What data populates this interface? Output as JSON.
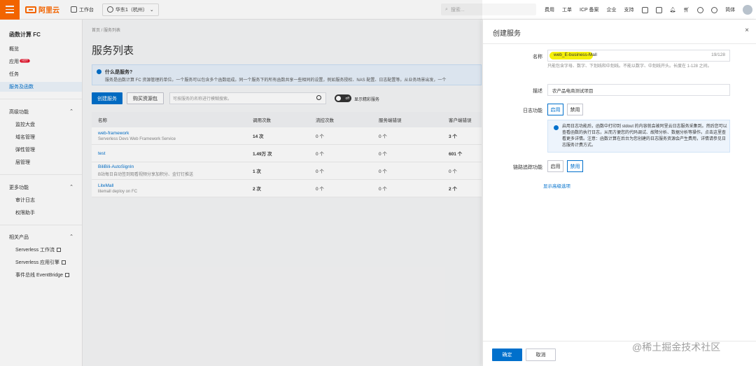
{
  "topbar": {
    "logo": "阿里云",
    "workbench": "工作台",
    "region": "华东1（杭州）",
    "search_placeholder": "搜索...",
    "links": [
      "费用",
      "工单",
      "ICP 备案",
      "企业",
      "支持"
    ],
    "lang": "简体"
  },
  "sidebar": {
    "title": "函数计算 FC",
    "items": [
      "概览",
      "应用",
      "任务",
      "服务及函数"
    ],
    "hot_badge": "HOT",
    "section_advanced": "高级功能",
    "advanced_items": [
      "监控大盘",
      "域名管理",
      "弹性管理",
      "层管理"
    ],
    "section_more": "更多功能",
    "more_items": [
      "审计日志",
      "权限助手"
    ],
    "section_related": "相关产品",
    "related_items": [
      "Serverless 工作流",
      "Serverless 应用引擎",
      "事件总线 EventBridge"
    ]
  },
  "main": {
    "breadcrumb": "首页 / 服务列表",
    "title": "服务列表",
    "notice_title": "什么是服务?",
    "notice_text": "服务是函数计算 FC 资源管理的单位。一个服务可以包含多个函数组成。同一个服务下的所有函数共享一些相同的设置，例如服务授权、NAS 配置、日志配置等。从业务场景出发，一个",
    "create_button": "创建服务",
    "resource_pack_button": "购买资源包",
    "filter_placeholder": "可按服务的名称进行模糊搜索。",
    "toggle_text": "off",
    "toggle_label": "显示精彩服务",
    "columns": [
      "名称",
      "调用次数",
      "流控次数",
      "服务端错误",
      "客户端错误"
    ],
    "rows": [
      {
        "name": "web-framework",
        "desc": "Serverless Devs Web Framework Service",
        "calls": "14 次",
        "throttles": "0 个",
        "server_errors": "0 个",
        "client_errors": "3 个"
      },
      {
        "name": "test",
        "desc": "",
        "calls": "1.49万 次",
        "throttles": "0 个",
        "server_errors": "0 个",
        "client_errors": "601 个"
      },
      {
        "name": "BiliBili-AutoSignIn",
        "desc": "B站每日自动签到观看视频分享加积分、金钉钉推送",
        "calls": "1 次",
        "throttles": "0 个",
        "server_errors": "0 个",
        "client_errors": "0 个"
      },
      {
        "name": "LiteMall",
        "desc": "litemall deploy on FC",
        "calls": "2 次",
        "throttles": "0 个",
        "server_errors": "0 个",
        "client_errors": "2 个"
      }
    ]
  },
  "drawer": {
    "title": "创建服务",
    "close": "×",
    "name_label": "名称",
    "name_value": "web_E-business-Mall",
    "name_count": "19/128",
    "name_hint": "只能包含字母、数字、下划线和中划线。不能以数字、中划线开头。长度在 1-128 之间。",
    "desc_label": "描述",
    "desc_value": "农产品电商测试项目",
    "log_label": "日志功能",
    "enable": "启用",
    "disable": "禁用",
    "log_info": "启用日志功能后，函数中打印到 stdout 的内容就会被阿里云日志服务采集到。然后您可以查看函数的执行日志，从而方便您的代码调试、故障分析、数据分析等操作。点击这里查看更多详情。注意：函数计算在后台为您创建的日志服务资源会产生费用，详情请参见日志服务计费方式。",
    "trace_label": "链路追踪功能",
    "advanced_link": "显示高级选项",
    "confirm": "确定",
    "cancel": "取消"
  },
  "watermark": "@稀土掘金技术社区",
  "colors": {
    "accent": "#ff6a00",
    "primary": "#0070cc",
    "highlight": "#f5f00a"
  }
}
